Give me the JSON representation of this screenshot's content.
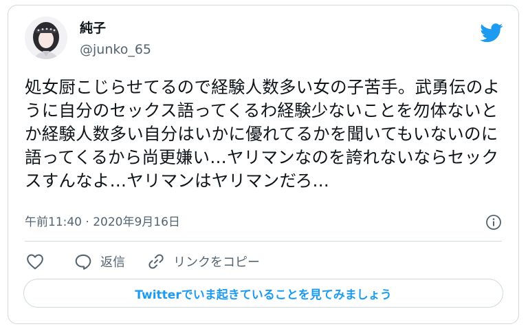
{
  "user": {
    "display_name": "純子",
    "handle": "@junko_65"
  },
  "tweet": {
    "text": "処女厨こじらせてるので経験人数多い女の子苦手。武勇伝のように自分のセックス語ってくるわ経験少ないことを勿体ないとか経験人数多い自分はいかに優れてるかを聞いてもいないのに語ってくるから尚更嫌い…ヤリマンなのを誇れないならセックスすんなよ…ヤリマンはヤリマンだろ…",
    "timestamp": "午前11:40 · 2020年9月16日"
  },
  "actions": {
    "like_icon": "heart-icon",
    "reply_label": "返信",
    "copy_link_label": "リンクをコピー"
  },
  "cta_label": "Twitterでいま起きていることを見てみましょう",
  "colors": {
    "accent": "#1d9bf0",
    "secondary_text": "#536471",
    "border": "#cfd9de"
  }
}
